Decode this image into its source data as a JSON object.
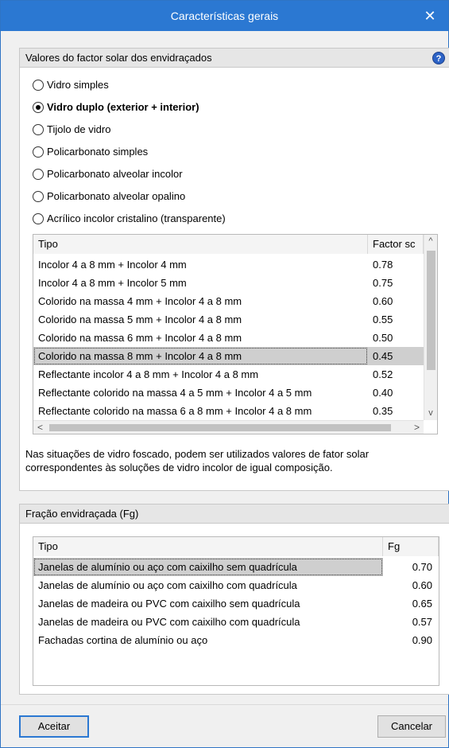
{
  "window": {
    "title": "Características gerais",
    "close_label": "✕"
  },
  "solar": {
    "header": "Valores do factor solar dos envidraçados",
    "help_label": "?",
    "radios": [
      {
        "label": "Vidro simples",
        "checked": false
      },
      {
        "label": "Vidro duplo (exterior + interior)",
        "checked": true
      },
      {
        "label": "Tijolo de vidro",
        "checked": false
      },
      {
        "label": "Policarbonato simples",
        "checked": false
      },
      {
        "label": "Policarbonato alveolar incolor",
        "checked": false
      },
      {
        "label": "Policarbonato alveolar opalino",
        "checked": false
      },
      {
        "label": "Acrílico incolor cristalino (transparente)",
        "checked": false
      }
    ],
    "table": {
      "col_tipo": "Tipo",
      "col_factor": "Factor sc",
      "rows": [
        {
          "tipo": "Incolor 4 a 8 mm + Incolor 4 mm",
          "factor": "0.78"
        },
        {
          "tipo": "Incolor 4 a 8 mm + Incolor 5 mm",
          "factor": "0.75"
        },
        {
          "tipo": "Colorido na massa 4 mm + Incolor 4 a 8 mm",
          "factor": "0.60"
        },
        {
          "tipo": "Colorido na massa 5 mm + Incolor 4 a 8 mm",
          "factor": "0.55"
        },
        {
          "tipo": "Colorido na massa 6 mm + Incolor 4 a 8 mm",
          "factor": "0.50"
        },
        {
          "tipo": "Colorido na massa 8 mm + Incolor 4 a 8 mm",
          "factor": "0.45"
        },
        {
          "tipo": "Reflectante incolor 4 a 8 mm + Incolor 4 a 8 mm",
          "factor": "0.52"
        },
        {
          "tipo": "Reflectante colorido na massa 4 a 5 mm + Incolor 4 a 5 mm",
          "factor": "0.40"
        },
        {
          "tipo": "Reflectante colorido na massa 6 a 8 mm + Incolor 4 a 8 mm",
          "factor": "0.35"
        }
      ],
      "selected_row": "Colorido na massa 8 mm + Incolor 4 a 8 mm",
      "scroll_up": "^",
      "scroll_down": "v",
      "scroll_left": "<",
      "scroll_right": ">"
    },
    "note": "Nas situações de vidro foscado, podem ser utilizados valores de fator solar correspondentes às soluções de vidro incolor de igual composição."
  },
  "fg": {
    "header": "Fração envidraçada (Fg)",
    "col_tipo": "Tipo",
    "col_fg": "Fg",
    "rows": [
      {
        "tipo": "Janelas de alumínio ou aço com caixilho sem quadrícula",
        "fg": "0.70"
      },
      {
        "tipo": "Janelas de alumínio ou aço com caixilho com quadrícula",
        "fg": "0.60"
      },
      {
        "tipo": "Janelas de madeira ou PVC com caixilho sem quadrícula",
        "fg": "0.65"
      },
      {
        "tipo": "Janelas de madeira ou PVC com caixilho com quadrícula",
        "fg": "0.57"
      },
      {
        "tipo": "Fachadas cortina de alumínio ou aço",
        "fg": "0.90"
      }
    ],
    "selected_row": "Janelas de alumínio ou aço com caixilho sem quadrícula"
  },
  "buttons": {
    "accept": "Aceitar",
    "cancel": "Cancelar"
  },
  "colors": {
    "titlebar": "#2b78d2",
    "selection": "#cfcfcf",
    "panel_header": "#e6e6e6"
  }
}
